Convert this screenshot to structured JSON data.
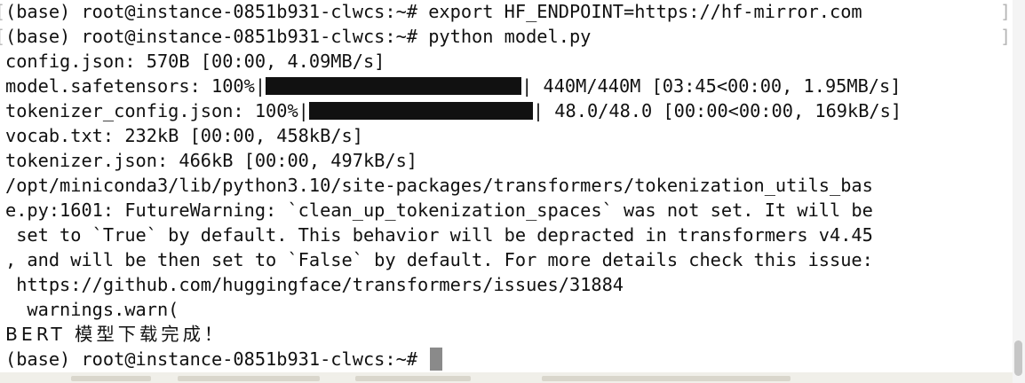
{
  "terminal": {
    "lines": [
      "(base) root@instance-0851b931-clwcs:~# export HF_ENDPOINT=https://hf-mirror.com",
      "(base) root@instance-0851b931-clwcs:~# python model.py",
      "config.json: 570B [00:00, 4.09MB/s]",
      "",
      "",
      "vocab.txt: 232kB [00:00, 458kB/s]",
      "tokenizer.json: 466kB [00:00, 497kB/s]",
      "/opt/miniconda3/lib/python3.10/site-packages/transformers/tokenization_utils_bas",
      "e.py:1601: FutureWarning: `clean_up_tokenization_spaces` was not set. It will be",
      " set to `True` by default. This behavior will be depracted in transformers v4.45",
      ", and will be then set to `False` by default. For more details check this issue:",
      " https://github.com/huggingface/transformers/issues/31884",
      "  warnings.warn(",
      "BERT 模型下载完成！",
      "(base) root@instance-0851b931-clwcs:~# "
    ],
    "progress": [
      {
        "label": "model.safetensors: 100%|",
        "percent": 100,
        "tail": "| 440M/440M [03:45<00:00, 1.95MB/s]"
      },
      {
        "label": "tokenizer_config.json: 100%|",
        "percent": 100,
        "tail": "| 48.0/48.0 [00:00<00:00, 169kB/s]"
      }
    ],
    "bracket_left": "[",
    "bracket_right": "]",
    "colors": {
      "text": "#111111",
      "cursor": "#8a8a8a",
      "background": "#ffffff"
    }
  }
}
